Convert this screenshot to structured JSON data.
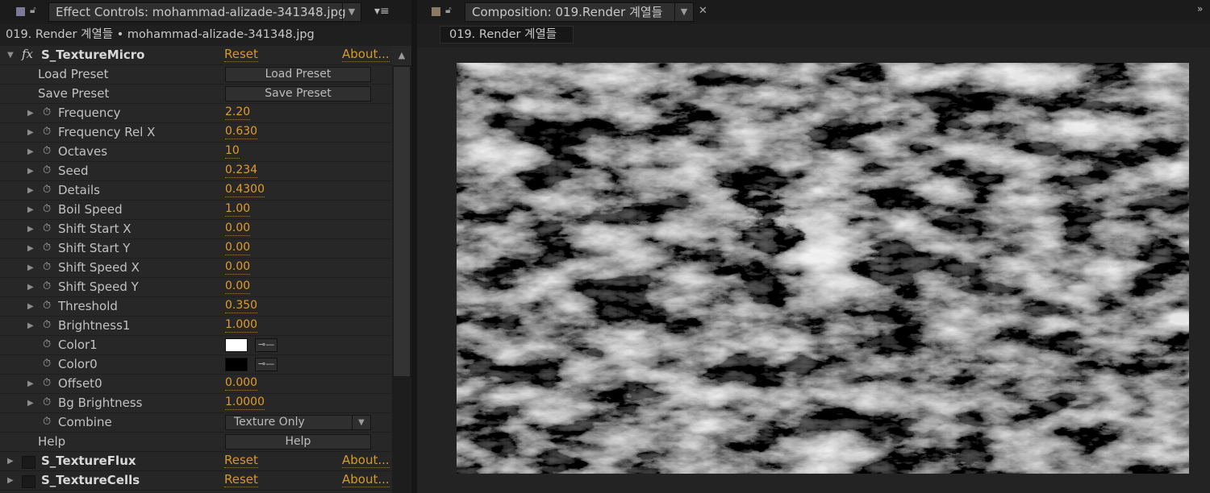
{
  "effect_panel": {
    "tab_title": "Effect Controls: mohammad-alizade-341348.jpg",
    "menu_icon": "hamburger-menu-icon",
    "breadcrumb": "019. Render 계열들 • mohammad-alizade-341348.jpg",
    "effect": {
      "name": "S_TextureMicro",
      "reset_label": "Reset",
      "about_label": "About...",
      "rows": [
        {
          "kind": "button",
          "name": "Load Preset",
          "button": "Load Preset"
        },
        {
          "kind": "button",
          "name": "Save Preset",
          "button": "Save Preset"
        },
        {
          "kind": "param",
          "name": "Frequency",
          "value": "2.20"
        },
        {
          "kind": "param",
          "name": "Frequency Rel X",
          "value": "0.630"
        },
        {
          "kind": "param",
          "name": "Octaves",
          "value": "10"
        },
        {
          "kind": "param",
          "name": "Seed",
          "value": "0.234"
        },
        {
          "kind": "param",
          "name": "Details",
          "value": "0.4300"
        },
        {
          "kind": "param",
          "name": "Boil Speed",
          "value": "1.00"
        },
        {
          "kind": "param",
          "name": "Shift Start X",
          "value": "0.00"
        },
        {
          "kind": "param",
          "name": "Shift Start Y",
          "value": "0.00"
        },
        {
          "kind": "param",
          "name": "Shift Speed X",
          "value": "0.00"
        },
        {
          "kind": "param",
          "name": "Shift Speed Y",
          "value": "0.00"
        },
        {
          "kind": "param",
          "name": "Threshold",
          "value": "0.350"
        },
        {
          "kind": "param",
          "name": "Brightness1",
          "value": "1.000"
        },
        {
          "kind": "color",
          "name": "Color1",
          "color": "#ffffff"
        },
        {
          "kind": "color",
          "name": "Color0",
          "color": "#000000"
        },
        {
          "kind": "param",
          "name": "Offset0",
          "value": "0.000"
        },
        {
          "kind": "param",
          "name": "Bg Brightness",
          "value": "1.0000"
        },
        {
          "kind": "dropdown",
          "name": "Combine",
          "value": "Texture Only"
        },
        {
          "kind": "button",
          "name": "Help",
          "button": "Help"
        }
      ]
    },
    "collapsed_effects": [
      {
        "name": "S_TextureFlux",
        "reset_label": "Reset",
        "about_label": "About..."
      },
      {
        "name": "S_TextureCells",
        "reset_label": "Reset",
        "about_label": "About..."
      }
    ]
  },
  "composition_panel": {
    "tab_title": "Composition: 019.Render 계열들",
    "breadcrumb": "019. Render 계열들",
    "menu_icon": "chevron-right-double-icon"
  },
  "colors": {
    "accent": "#e09d2c",
    "panel_bg": "#262626",
    "viewer_bg": "#000000"
  }
}
